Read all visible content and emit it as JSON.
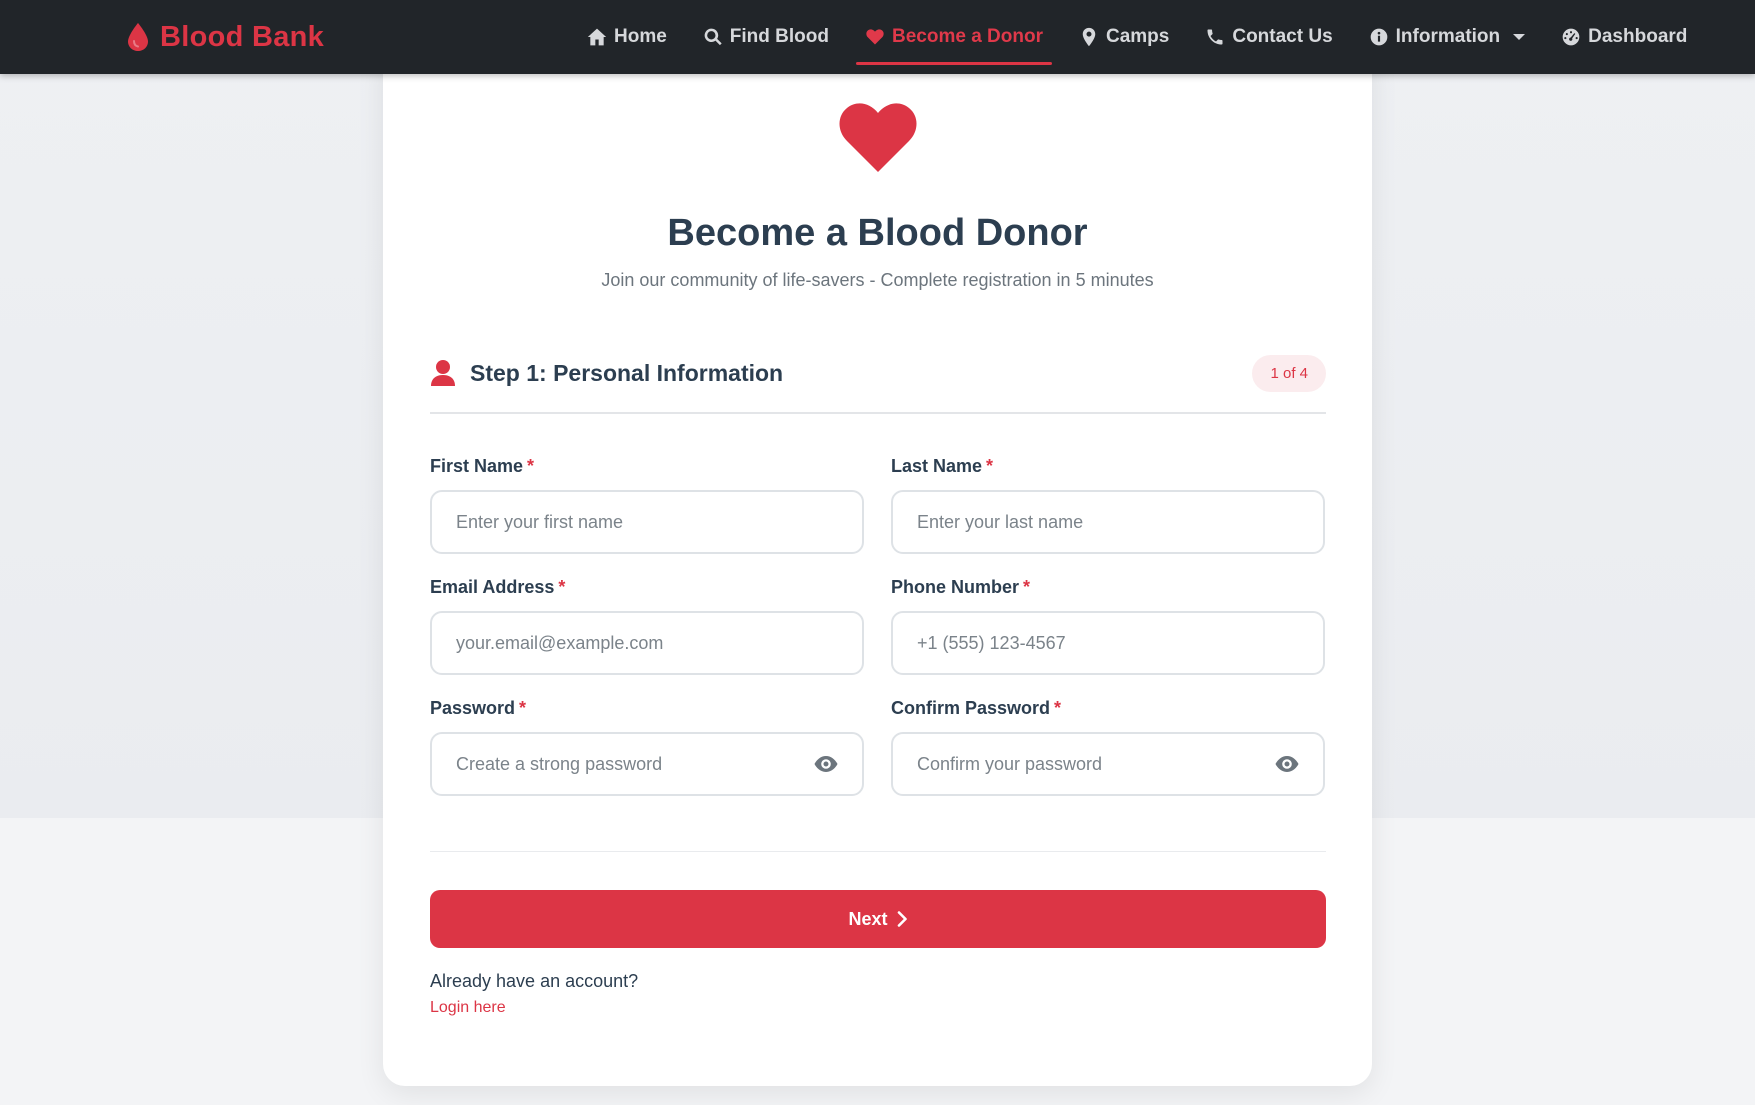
{
  "colors": {
    "accent": "#dc3545",
    "navbar": "#212529",
    "text": "#2c3e50",
    "muted": "#6c757d"
  },
  "navbar": {
    "brand": "Blood Bank",
    "brand_icon": "blood-drop-icon",
    "items": [
      {
        "label": "Home",
        "icon": "home-icon",
        "active": false
      },
      {
        "label": "Find Blood",
        "icon": "search-icon",
        "active": false
      },
      {
        "label": "Become a Donor",
        "icon": "heart-icon",
        "active": true
      },
      {
        "label": "Camps",
        "icon": "map-pin-icon",
        "active": false
      },
      {
        "label": "Contact Us",
        "icon": "phone-icon",
        "active": false
      },
      {
        "label": "Information",
        "icon": "info-circle-icon",
        "active": false,
        "dropdown": true
      },
      {
        "label": "Dashboard",
        "icon": "dashboard-gauge-icon",
        "active": false
      }
    ]
  },
  "header": {
    "title": "Become a Blood Donor",
    "subtitle": "Join our community of life-savers - Complete registration in 5 minutes"
  },
  "step": {
    "title": "Step 1: Personal Information",
    "badge": "1 of 4",
    "current": 1,
    "total": 4
  },
  "fields": {
    "first_name": {
      "label": "First Name",
      "required": "*",
      "placeholder": "Enter your first name",
      "value": ""
    },
    "last_name": {
      "label": "Last Name",
      "required": "*",
      "placeholder": "Enter your last name",
      "value": ""
    },
    "email": {
      "label": "Email Address",
      "required": "*",
      "placeholder": "your.email@example.com",
      "value": ""
    },
    "phone": {
      "label": "Phone Number",
      "required": "*",
      "placeholder": "+1 (555) 123-4567",
      "value": ""
    },
    "password": {
      "label": "Password",
      "required": "*",
      "placeholder": "Create a strong password",
      "value": ""
    },
    "confirm_password": {
      "label": "Confirm Password",
      "required": "*",
      "placeholder": "Confirm your password",
      "value": ""
    }
  },
  "actions": {
    "next_label": "Next",
    "already_text": "Already have an account?",
    "login_label": "Login here"
  }
}
